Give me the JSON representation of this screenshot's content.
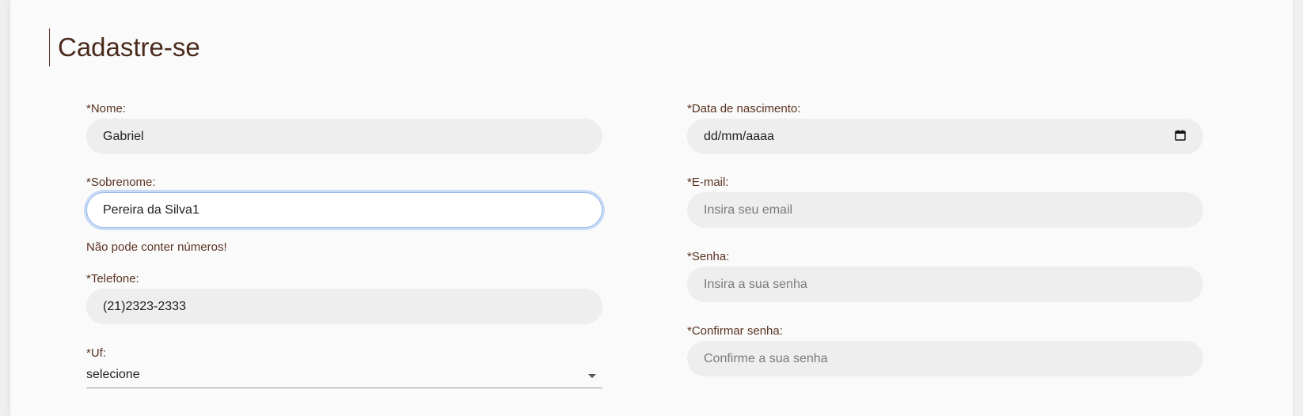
{
  "page": {
    "title": "Cadastre-se"
  },
  "form": {
    "nome": {
      "label": "*Nome:",
      "value": "Gabriel"
    },
    "sobrenome": {
      "label": "*Sobrenome:",
      "value": "Pereira da Silva1",
      "error": "Não pode conter números!"
    },
    "telefone": {
      "label": "*Telefone:",
      "value": "(21)2323-2333"
    },
    "uf": {
      "label": "*Uf:",
      "selected": "selecione"
    },
    "nascimento": {
      "label": "*Data de nascimento:",
      "value": "dd/mm/aaaa",
      "icon": "calendar-icon"
    },
    "email": {
      "label": "*E-mail:",
      "placeholder": "Insira seu email"
    },
    "senha": {
      "label": "*Senha:",
      "placeholder": "Insira a sua senha"
    },
    "confirmar": {
      "label": "*Confirmar senha:",
      "placeholder": "Confirme a sua senha"
    }
  },
  "colors": {
    "label": "#5a3220",
    "input_bg": "#eeeeee",
    "focus_ring": "#c7dbf7",
    "card_bg": "#fafafa"
  }
}
